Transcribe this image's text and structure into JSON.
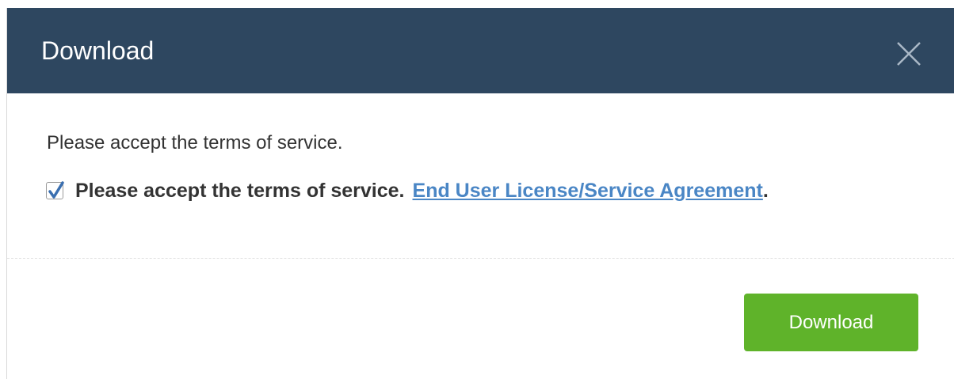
{
  "dialog": {
    "title": "Download",
    "close_icon": "close-icon",
    "message": "Please accept the terms of service.",
    "terms_checkbox": {
      "checked": true,
      "label": "Please accept the terms of service.",
      "link_text": "End User License/Service Agreement",
      "trailing": "."
    },
    "download_button_label": "Download"
  },
  "colors": {
    "header_bg": "#2e4760",
    "button_bg": "#5fb32a",
    "link": "#4a86c5"
  }
}
